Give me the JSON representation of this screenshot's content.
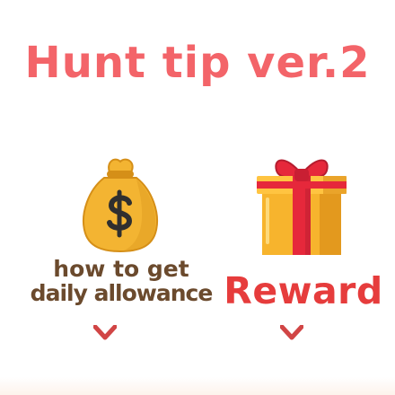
{
  "title": "Hunt tip ver.2",
  "left_caption": {
    "line1": "how to get",
    "line2": "daily allowance"
  },
  "right_caption": "Reward",
  "icons": {
    "left": "money-bag-icon",
    "right": "gift-box-icon",
    "left_arrow": "chevron-down-icon",
    "right_arrow": "chevron-down-icon"
  },
  "colors": {
    "title": "#f36469",
    "left_text": "#6b4a2d",
    "right_text": "#e63c3c",
    "arrow": "#d14545",
    "bag": "#f3b432",
    "bag_shadow": "#d58f18",
    "bag_symbol": "#2f2f2f",
    "gift_box": "#f7b42d",
    "gift_ribbon": "#e6283b",
    "gift_side": "#d98a17"
  }
}
